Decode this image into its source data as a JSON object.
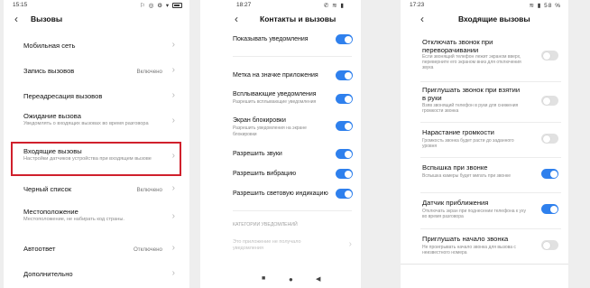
{
  "panel1": {
    "time": "15:15",
    "status_icons": "⚐ ◎ ⚙ ▾",
    "title": "Вызовы",
    "items": [
      {
        "label": "Мобильная сеть"
      },
      {
        "label": "Запись вызовов",
        "value": "Включено"
      },
      {
        "label": "Переадресация вызовов"
      },
      {
        "label": "Ожидание вызова",
        "desc": "Уведомлять о входящих вызовах во время разговора"
      },
      {
        "label": "Входящие вызовы",
        "desc": "Настройки датчиков устройства при входящем вызове"
      },
      {
        "label": "Черный список",
        "value": "Включено"
      },
      {
        "label": "Местоположение",
        "desc": "Местоположение, не набирать код страны."
      },
      {
        "label": "Автоответ",
        "value": "Отключено"
      },
      {
        "label": "Дополнительно"
      }
    ]
  },
  "panel2": {
    "time": "18:27",
    "status_icons": "✆ ≋ ▮",
    "title": "Контакты и вызовы",
    "items": [
      {
        "label": "Показывать уведомления",
        "on": true
      },
      {
        "label": "Метка на значке приложения",
        "on": true
      },
      {
        "label": "Всплывающие уведомления",
        "desc": "Разрешить всплывающие уведомления",
        "on": true
      },
      {
        "label": "Экран блокировки",
        "desc": "Разрешить уведомления на экране блокировки",
        "on": true
      },
      {
        "label": "Разрешить звуки",
        "on": true
      },
      {
        "label": "Разрешить вибрацию",
        "on": true
      },
      {
        "label": "Разрешить световую индикацию",
        "on": true
      }
    ],
    "category_header": "КАТЕГОРИИ УВЕДОМЛЕНИЙ",
    "category_note": "Это приложение не получало уведомления",
    "nav": {
      "recents": "■",
      "home": "●",
      "back": "◀"
    }
  },
  "panel3": {
    "time": "17:23",
    "status_icons": "≋ ▮ 58 %",
    "title": "Входящие вызовы",
    "items": [
      {
        "label": "Отключать звонок при переворачивании",
        "desc": "Если звонящий телефон лежит экраном вверх, переверните его экраном вниз для отключения звука",
        "on": false
      },
      {
        "label": "Приглушать звонок при взятии в руки",
        "desc": "Взяв звонящий телефон в руки для снижения громкости звонка",
        "on": false
      },
      {
        "label": "Нарастание громкости",
        "desc": "Громкость звонка будет расти до заданного уровня",
        "on": false
      },
      {
        "label": "Вспышка при звонке",
        "desc": "Вспышка камеры будет мигать при звонке",
        "on": true
      },
      {
        "label": "Датчик приближения",
        "desc": "Отключать экран при поднесении телефона к уху во время разговора",
        "on": true
      },
      {
        "label": "Приглушать начало звонка",
        "desc": "Не проигрывать начало звонка для вызова с неизвестного номера",
        "on": false
      }
    ]
  },
  "colors": {
    "accent": "#2f80ed",
    "highlight": "#d0202c",
    "divider": "#ececec",
    "muted": "#8a8a8a"
  }
}
